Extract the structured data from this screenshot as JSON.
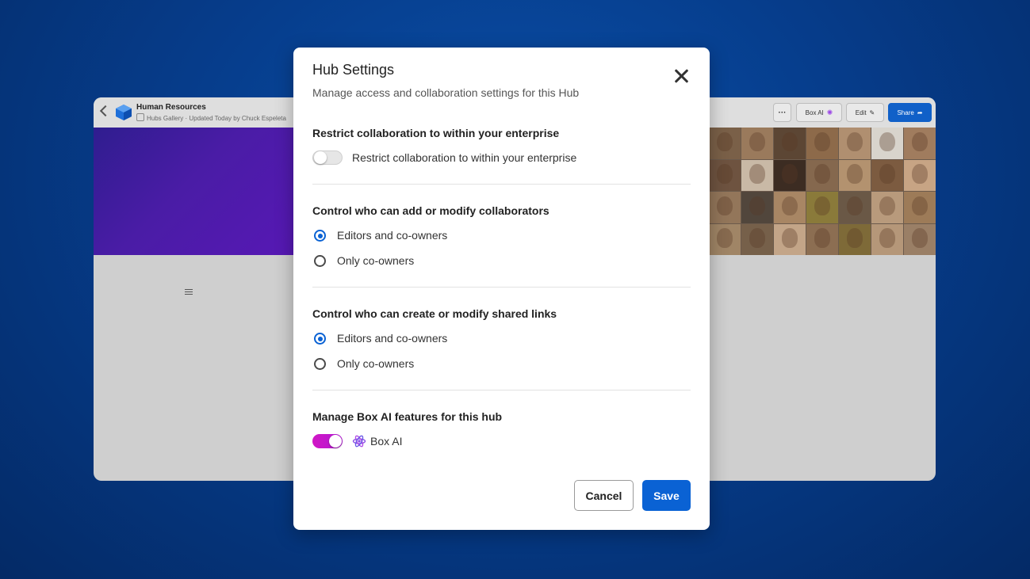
{
  "background_app": {
    "hub_title": "Human Resources",
    "hub_subtitle": "Hubs Gallery · Updated Today by Chuck Espeleta",
    "more_label": "···",
    "box_ai_label": "Box AI",
    "edit_label": "Edit",
    "share_label": "Share"
  },
  "modal": {
    "title": "Hub Settings",
    "subtitle": "Manage access and collaboration settings for this Hub",
    "restrict": {
      "heading": "Restrict collaboration to within your enterprise",
      "toggle_label": "Restrict collaboration to within your enterprise",
      "enabled": false
    },
    "collaborators": {
      "heading": "Control who can add or modify collaborators",
      "options": [
        "Editors and co-owners",
        "Only co-owners"
      ],
      "selected": "Editors and co-owners"
    },
    "shared_links": {
      "heading": "Control who can create or modify shared links",
      "options": [
        "Editors and co-owners",
        "Only co-owners"
      ],
      "selected": "Editors and co-owners"
    },
    "box_ai": {
      "heading": "Manage Box AI features for this hub",
      "toggle_label": "Box AI",
      "enabled": true
    },
    "cancel_label": "Cancel",
    "save_label": "Save"
  },
  "colors": {
    "accent": "#0a62d4",
    "box_ai_toggle": "#c918c9",
    "background": "#063d8c"
  },
  "icons": [
    "chevron-left-icon",
    "hub-logo-icon",
    "close-icon",
    "box-ai-icon",
    "edit-pencil-icon",
    "share-arrow-icon",
    "list-icon"
  ]
}
